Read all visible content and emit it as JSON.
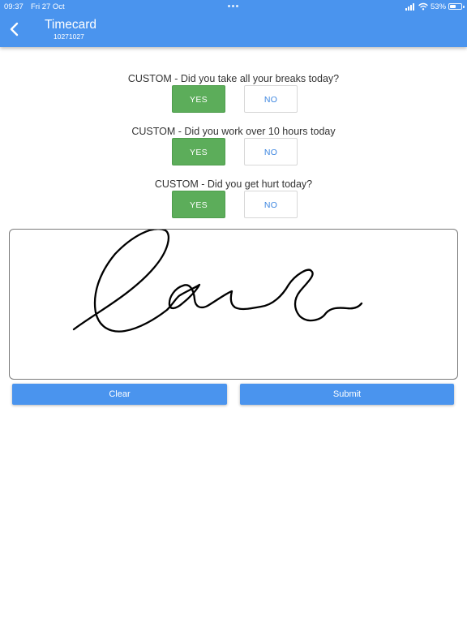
{
  "status_bar": {
    "time": "09:37",
    "date": "Fri 27 Oct",
    "battery": "53%",
    "battery_level": 0.53
  },
  "header": {
    "back_icon": "chevron-left-icon",
    "title": "Timecard",
    "subtitle": "10271027",
    "color": "#4a94ee"
  },
  "questions": [
    {
      "text": "CUSTOM - Did you take all your breaks today?",
      "yes_label": "YES",
      "no_label": "NO",
      "selected": "yes"
    },
    {
      "text": "CUSTOM - Did you work over 10 hours today",
      "yes_label": "YES",
      "no_label": "NO",
      "selected": "yes"
    },
    {
      "text": "CUSTOM - Did you get hurt today?",
      "yes_label": "YES",
      "no_label": "NO",
      "selected": "yes"
    }
  ],
  "colors": {
    "selected": "#5cad5a",
    "unselected_text": "#3d86e0",
    "accent": "#4a94ee"
  },
  "actions": {
    "clear_label": "Clear",
    "submit_label": "Submit"
  }
}
